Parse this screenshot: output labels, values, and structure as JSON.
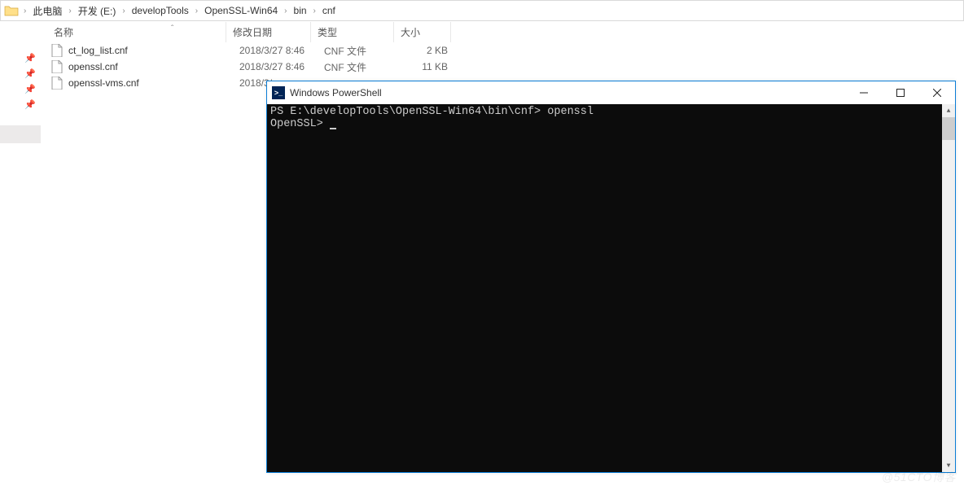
{
  "breadcrumb": {
    "items": [
      "此电脑",
      "开发 (E:)",
      "developTools",
      "OpenSSL-Win64",
      "bin",
      "cnf"
    ]
  },
  "columns": {
    "name": "名称",
    "date": "修改日期",
    "type": "类型",
    "size": "大小"
  },
  "files": [
    {
      "name": "ct_log_list.cnf",
      "date": "2018/3/27 8:46",
      "type": "CNF 文件",
      "size": "2 KB"
    },
    {
      "name": "openssl.cnf",
      "date": "2018/3/27 8:46",
      "type": "CNF 文件",
      "size": "11 KB"
    },
    {
      "name": "openssl-vms.cnf",
      "date": "2018/3/",
      "type": "",
      "size": ""
    }
  ],
  "powershell": {
    "title": "Windows PowerShell",
    "line1_prompt": "PS E:\\developTools\\OpenSSL-Win64\\bin\\cnf> ",
    "line1_cmd": "openssl",
    "line2": "OpenSSL> "
  },
  "watermark": "@51CTO博客"
}
